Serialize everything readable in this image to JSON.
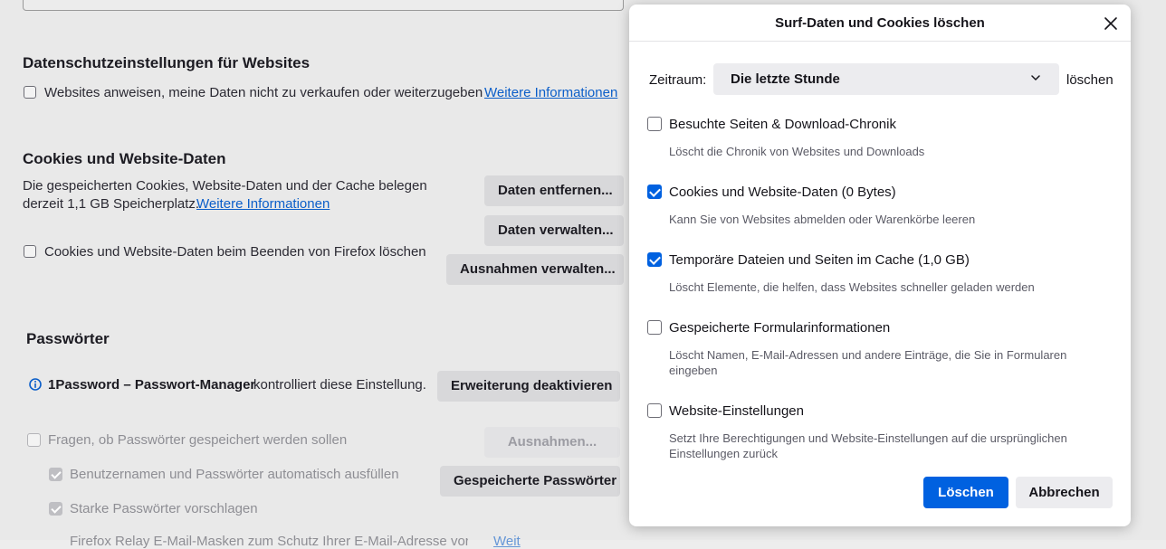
{
  "background": {
    "privacy": {
      "heading": "Datenschutzeinstellungen für Websites",
      "checkbox_label": "Websites anweisen, meine Daten nicht zu verkaufen oder weiterzugeben",
      "link": "Weitere Informationen"
    },
    "cookies": {
      "heading": "Cookies und Website-Daten",
      "desc_line1": "Die gespeicherten Cookies, Website-Daten und der Cache belegen",
      "desc_line2": "derzeit 1,1 GB Speicherplatz.",
      "link": "Weitere Informationen",
      "remove_button": "Daten entfernen...",
      "manage_button": "Daten verwalten...",
      "exceptions_button": "Ausnahmen verwalten...",
      "delete_on_close_label": "Cookies und Website-Daten beim Beenden von Firefox löschen"
    },
    "passwords": {
      "heading": "Passwörter",
      "extension_name": "1Password – Passwort-Manager",
      "extension_text": "kontrolliert diese Einstellung.",
      "disable_extension_button": "Erweiterung deaktivieren",
      "ask_save_label": "Fragen, ob Passwörter gespeichert werden sollen",
      "exceptions_button": "Ausnahmen...",
      "autofill_label": "Benutzernamen und Passwörter automatisch ausfüllen",
      "saved_passwords_button": "Gespeicherte Passwörter",
      "suggest_strong_label": "Starke Passwörter vorschlagen",
      "cut_off_text": "Firefox Relay E-Mail-Masken zum Schutz Ihrer E-Mail-Adresse vorschlagen",
      "cut_off_link": "Weit"
    }
  },
  "dialog": {
    "title": "Surf-Daten und Cookies löschen",
    "timerange_label": "Zeitraum:",
    "timerange_value": "Die letzte Stunde",
    "timerange_suffix": "löschen",
    "options": [
      {
        "label": "Besuchte Seiten & Download-Chronik",
        "description": "Löscht die Chronik von Websites und Downloads",
        "checked": false
      },
      {
        "label": "Cookies und Website-Daten (0 Bytes)",
        "description": "Kann Sie von Websites abmelden oder Warenkörbe leeren",
        "checked": true
      },
      {
        "label": "Temporäre Dateien und Seiten im Cache (1,0 GB)",
        "description": "Löscht Elemente, die helfen, dass Websites schneller geladen werden",
        "checked": true
      },
      {
        "label": "Gespeicherte Formularinformationen",
        "description": "Löscht Namen, E-Mail-Adressen und andere Einträge, die Sie in Formularen eingeben",
        "checked": false
      },
      {
        "label": "Website-Einstellungen",
        "description": "Setzt Ihre Berechtigungen und Website-Einstellungen auf die ursprünglichen Einstellungen zurück",
        "checked": false
      }
    ],
    "confirm_button": "Löschen",
    "cancel_button": "Abbrechen"
  },
  "colors": {
    "accent": "#0061e0",
    "link": "#0b5ec9",
    "overlay_bg": "#e9e9e9"
  },
  "icons": {
    "close": "close-icon",
    "dropdown": "chevron-down-icon",
    "info": "info-icon"
  }
}
